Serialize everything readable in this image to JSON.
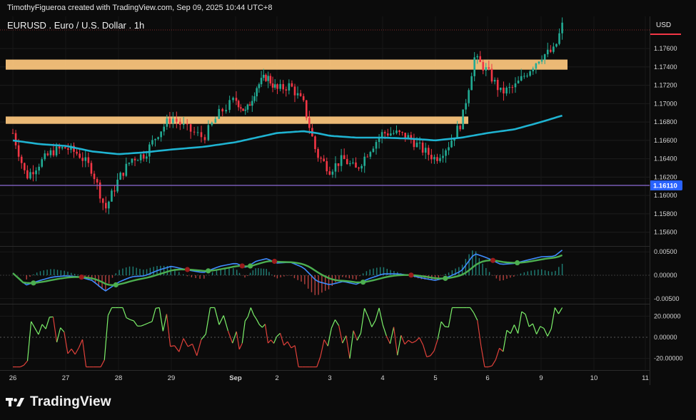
{
  "header": {
    "credit": "TimothyFigueroa created with TradingView.com, Sep 09, 2025 10:44 UTC+8"
  },
  "footer": {
    "brand": "TradingView",
    "logo_icon": "tradingview-logo-icon"
  },
  "colors": {
    "up": "#22ab94",
    "down": "#f23645",
    "ma": "#1fb3d1",
    "zone": "#ffc97f",
    "level_line": "#8d6bd6",
    "macd_fast": "#3f8cff",
    "macd_slow_up": "#4caf50",
    "macd_slow_down": "#9b1c1c",
    "osc_up": "#7cf06a",
    "osc_down": "#e0413a"
  },
  "chart_data": {
    "type": "candlestick",
    "title": "EURUSD . Euro / U.S. Dollar . 1h",
    "currency": "USD",
    "price_axis": {
      "ticks": [
        "1.17600",
        "1.17400",
        "1.17200",
        "1.17000",
        "1.16800",
        "1.16600",
        "1.16400",
        "1.16200",
        "1.16000",
        "1.15800",
        "1.15600"
      ],
      "range": [
        1.1545,
        1.1795
      ]
    },
    "time_axis": {
      "labels": [
        "26",
        "27",
        "28",
        "29",
        "Sep",
        "2",
        "3",
        "4",
        "5",
        "6",
        "9",
        "10",
        "11"
      ]
    },
    "horizontal_line": {
      "label": "1.16110",
      "price": 1.1611
    },
    "zones": [
      {
        "from": 1.1737,
        "to": 1.1748
      },
      {
        "from": 1.1678,
        "to": 1.1686
      }
    ],
    "close_path": [
      [
        26.0,
        1.1668
      ],
      [
        26.25,
        1.162
      ],
      [
        26.5,
        1.1635
      ],
      [
        26.75,
        1.1648
      ],
      [
        27.0,
        1.1652
      ],
      [
        27.25,
        1.1645
      ],
      [
        27.5,
        1.1628
      ],
      [
        27.75,
        1.1585
      ],
      [
        28.0,
        1.1618
      ],
      [
        28.25,
        1.164
      ],
      [
        28.5,
        1.1645
      ],
      [
        28.75,
        1.1668
      ],
      [
        29.0,
        1.1685
      ],
      [
        29.25,
        1.1672
      ],
      [
        29.5,
        1.1663
      ],
      [
        29.75,
        1.169
      ],
      [
        30.0,
        1.1705
      ],
      [
        30.25,
        1.169
      ],
      [
        30.5,
        1.1718
      ],
      [
        30.75,
        1.173
      ],
      [
        31.0,
        1.1715
      ],
      [
        31.25,
        1.172
      ],
      [
        31.5,
        1.17
      ],
      [
        31.75,
        1.1645
      ],
      [
        32.0,
        1.1628
      ],
      [
        32.25,
        1.164
      ],
      [
        32.5,
        1.1628
      ],
      [
        32.75,
        1.165
      ],
      [
        33.0,
        1.1668
      ],
      [
        33.25,
        1.1668
      ],
      [
        33.5,
        1.1663
      ],
      [
        33.75,
        1.165
      ],
      [
        34.0,
        1.164
      ],
      [
        34.25,
        1.1655
      ],
      [
        34.5,
        1.168
      ],
      [
        34.75,
        1.175
      ],
      [
        35.0,
        1.1735
      ],
      [
        35.25,
        1.1712
      ],
      [
        35.5,
        1.1718
      ],
      [
        35.75,
        1.1735
      ],
      [
        36.0,
        1.1752
      ],
      [
        36.25,
        1.1758
      ],
      [
        36.4,
        1.1785
      ]
    ],
    "ma_path": [
      [
        26.0,
        1.166
      ],
      [
        26.5,
        1.1656
      ],
      [
        27.0,
        1.1654
      ],
      [
        27.5,
        1.1648
      ],
      [
        28.0,
        1.1645
      ],
      [
        28.5,
        1.1647
      ],
      [
        29.0,
        1.165
      ],
      [
        29.5,
        1.1653
      ],
      [
        30.0,
        1.1658
      ],
      [
        30.5,
        1.1663
      ],
      [
        31.0,
        1.1668
      ],
      [
        31.5,
        1.167
      ],
      [
        31.75,
        1.1668
      ],
      [
        32.0,
        1.1665
      ],
      [
        32.5,
        1.1663
      ],
      [
        33.0,
        1.1663
      ],
      [
        33.5,
        1.1662
      ],
      [
        34.0,
        1.166
      ],
      [
        34.5,
        1.1663
      ],
      [
        35.0,
        1.1668
      ],
      [
        35.5,
        1.1672
      ],
      [
        36.0,
        1.168
      ],
      [
        36.4,
        1.1687
      ]
    ],
    "macd_panel": {
      "ticks": [
        "0.00500",
        "0.00000",
        "-0.00500"
      ],
      "range": [
        -0.0061,
        0.0061
      ]
    },
    "osc_panel": {
      "ticks": [
        "20.00000",
        "0.00000",
        "-20.00000"
      ],
      "range": [
        -31,
        31
      ]
    }
  }
}
